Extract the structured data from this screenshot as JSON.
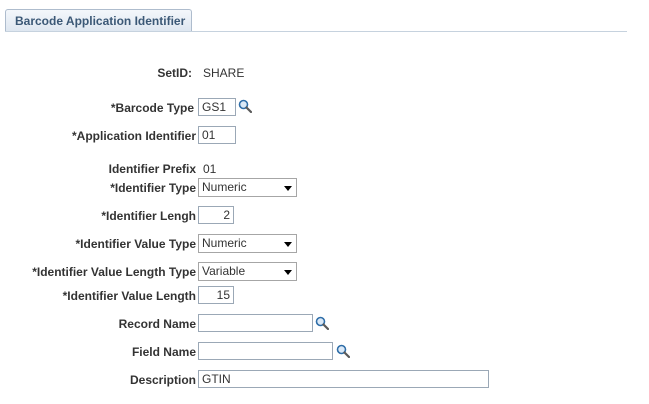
{
  "tab": {
    "label": "Barcode Application Identifier"
  },
  "form": {
    "setid": {
      "label": "SetID:",
      "value": "SHARE"
    },
    "barcode_type": {
      "label": "*Barcode Type",
      "value": "GS1"
    },
    "application_identifier": {
      "label": "*Application Identifier",
      "value": "01"
    },
    "identifier_prefix": {
      "label": "Identifier Prefix",
      "value": "01"
    },
    "identifier_type": {
      "label": "*Identifier Type",
      "value": "Numeric"
    },
    "identifier_length": {
      "label": "*Identifier Lengh",
      "value": "2"
    },
    "identifier_value_type": {
      "label": "*Identifier Value Type",
      "value": "Numeric"
    },
    "identifier_value_length_type": {
      "label": "*Identifier Value Length Type",
      "value": "Variable"
    },
    "identifier_value_length": {
      "label": "*Identifier Value Length",
      "value": "15"
    },
    "record_name": {
      "label": "Record Name",
      "value": ""
    },
    "field_name": {
      "label": "Field Name",
      "value": ""
    },
    "description": {
      "label": "Description",
      "value": "GTIN"
    }
  },
  "icons": {
    "lookup": "magnifier-lookup-icon"
  },
  "colors": {
    "tab_text": "#3b5876",
    "tab_border": "#aebccd",
    "input_border": "#9ba8b6"
  }
}
